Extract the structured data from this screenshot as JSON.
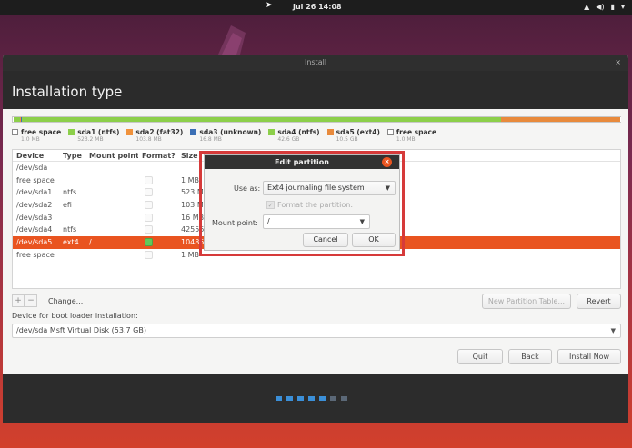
{
  "topbar": {
    "clock": "Jul 26  14:08",
    "tray_icons": [
      "network-icon",
      "volume-icon",
      "battery-icon",
      "menu-chevron-icon"
    ]
  },
  "window": {
    "title": "Install",
    "close": "×",
    "heading": "Installation type"
  },
  "partition_bar": {
    "segments": [
      {
        "name": "free space",
        "color": "#ffffff",
        "fraction": 0.002
      },
      {
        "name": "sda1 (ntfs)",
        "color": "#8ccf4a",
        "fraction": 0.01
      },
      {
        "name": "sda2 (fat32)",
        "color": "#f0923c",
        "fraction": 0.002
      },
      {
        "name": "sda3 (unknown)",
        "color": "#3b6fb5",
        "fraction": 0.0005
      },
      {
        "name": "sda4 (ntfs)",
        "color": "#8ccf4a",
        "fraction": 0.79
      },
      {
        "name": "sda5 (ext4)",
        "color": "#e88a3c",
        "fraction": 0.195
      },
      {
        "name": "free space",
        "color": "#ffffff",
        "fraction": 0.0005
      }
    ]
  },
  "legend": [
    {
      "label": "free space",
      "size": "1.0 MB",
      "color": "#ffffff",
      "empty": true
    },
    {
      "label": "sda1 (ntfs)",
      "size": "523.2 MB",
      "color": "#8ccf4a",
      "empty": false
    },
    {
      "label": "sda2 (fat32)",
      "size": "103.8 MB",
      "color": "#f0923c",
      "empty": false
    },
    {
      "label": "sda3 (unknown)",
      "size": "16.8 MB",
      "color": "#3b6fb5",
      "empty": false
    },
    {
      "label": "sda4 (ntfs)",
      "size": "42.6 GB",
      "color": "#8ccf4a",
      "empty": false
    },
    {
      "label": "sda5 (ext4)",
      "size": "10.5 GB",
      "color": "#e88a3c",
      "empty": false
    },
    {
      "label": "free space",
      "size": "1.0 MB",
      "color": "#ffffff",
      "empty": true
    }
  ],
  "table": {
    "headers": [
      "Device",
      "Type",
      "Mount point",
      "Format?",
      "Size",
      "Used"
    ],
    "rows": [
      {
        "device": "/dev/sda",
        "type": "",
        "mount": "",
        "format": null,
        "size": "",
        "selected": false
      },
      {
        "device": "free space",
        "type": "",
        "mount": "",
        "format": false,
        "size": "1 MB",
        "selected": false
      },
      {
        "device": "/dev/sda1",
        "type": "ntfs",
        "mount": "",
        "format": false,
        "size": "523 MB",
        "selected": false
      },
      {
        "device": "/dev/sda2",
        "type": "efi",
        "mount": "",
        "format": false,
        "size": "103 MB",
        "selected": false
      },
      {
        "device": "/dev/sda3",
        "type": "",
        "mount": "",
        "format": false,
        "size": "16 MB",
        "selected": false
      },
      {
        "device": "/dev/sda4",
        "type": "ntfs",
        "mount": "",
        "format": false,
        "size": "42555",
        "selected": false
      },
      {
        "device": "/dev/sda5",
        "type": "ext4",
        "mount": "/",
        "format": true,
        "size": "10485",
        "selected": true
      },
      {
        "device": "free space",
        "type": "",
        "mount": "",
        "format": false,
        "size": "1 MB",
        "selected": false
      }
    ]
  },
  "tools": {
    "add": "+",
    "remove": "−",
    "change": "Change..."
  },
  "buttons": {
    "new_table": "New Partition Table...",
    "revert": "Revert",
    "quit": "Quit",
    "back": "Back",
    "install": "Install Now"
  },
  "boot": {
    "label": "Device for boot loader installation:",
    "value": "/dev/sda   Msft Virtual Disk (53.7 GB)"
  },
  "progress": {
    "dots_total": 7,
    "dots_active": 5
  },
  "dialog": {
    "title": "Edit partition",
    "close": "×",
    "use_as_label": "Use as:",
    "use_as_value": "Ext4 journaling file system",
    "format_label": "Format the partition:",
    "format_checked": true,
    "mount_label": "Mount point:",
    "mount_value": "/",
    "cancel": "Cancel",
    "ok": "OK"
  }
}
